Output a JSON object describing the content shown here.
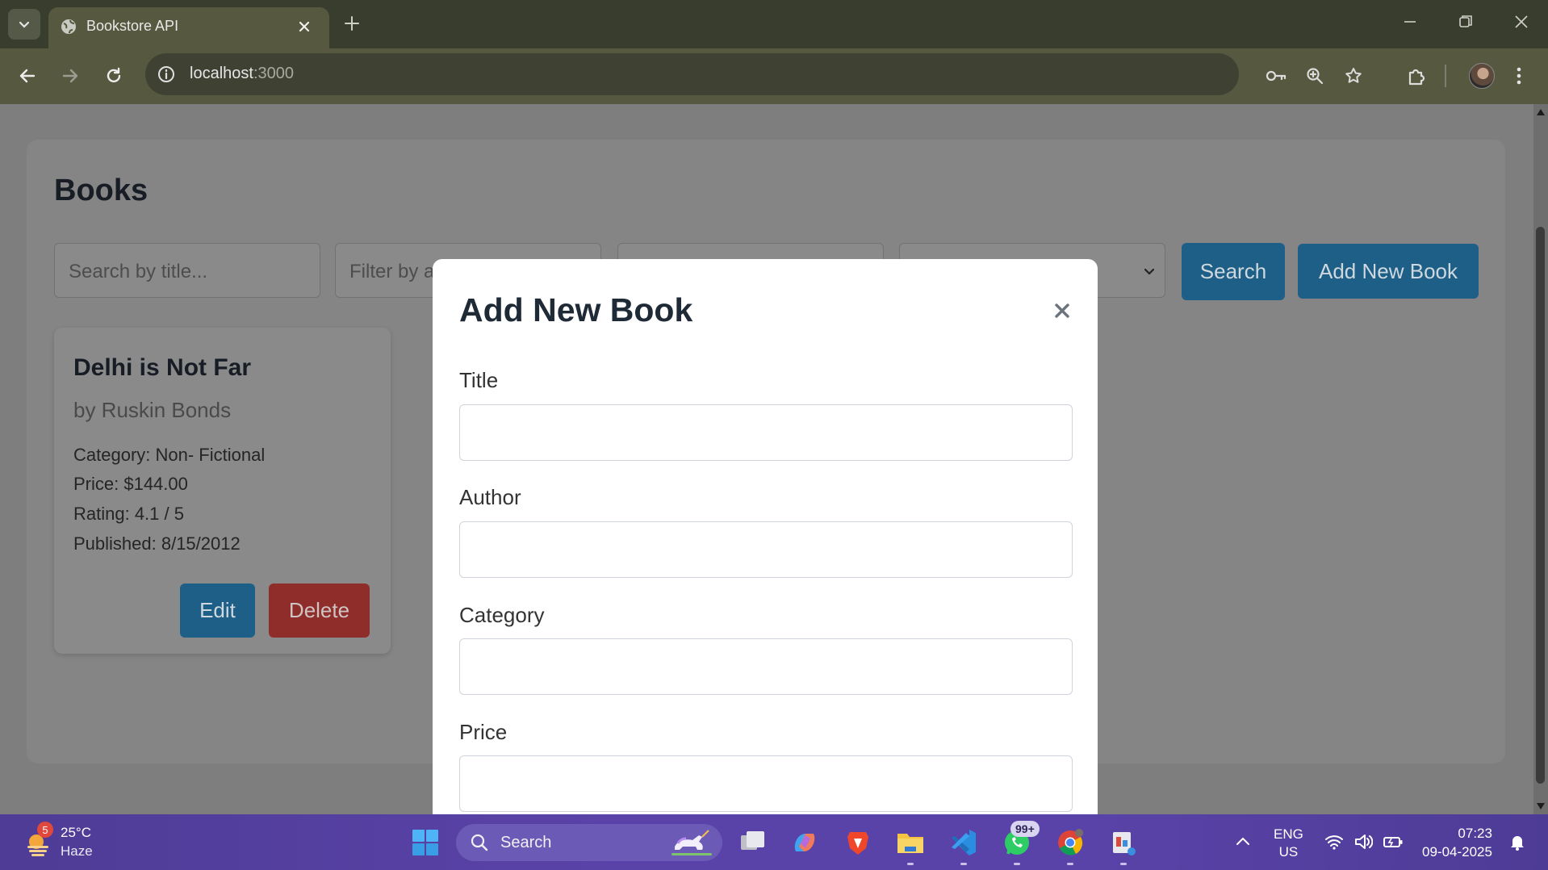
{
  "browser": {
    "tab_title": "Bookstore API",
    "url_host": "localhost",
    "url_path": ":3000"
  },
  "page": {
    "heading": "Books",
    "filters": {
      "search_placeholder": "Search by title...",
      "filter_placeholder": "Filter by a"
    },
    "search_button": "Search",
    "add_button": "Add New Book",
    "book": {
      "title": "Delhi is Not Far",
      "author": "by Ruskin Bonds",
      "category": "Category: Non- Fictional",
      "price": "Price: $144.00",
      "rating": "Rating: 4.1 / 5",
      "published": "Published: 8/15/2012",
      "edit_label": "Edit",
      "delete_label": "Delete"
    }
  },
  "modal": {
    "title": "Add New Book",
    "close_symbol": "×",
    "fields": {
      "title_label": "Title",
      "author_label": "Author",
      "category_label": "Category",
      "price_label": "Price"
    }
  },
  "taskbar": {
    "weather_badge": "5",
    "temperature": "25°C",
    "weather": "Haze",
    "search": "Search",
    "whatsapp_badge": "99+",
    "lang_top": "ENG",
    "lang_bottom": "US",
    "time": "07:23",
    "date": "09-04-2025"
  },
  "colors": {
    "primary": "#1d5f87",
    "danger": "#8f2d2a",
    "taskbar": "#5a43a8",
    "chrome": "#56593f"
  }
}
